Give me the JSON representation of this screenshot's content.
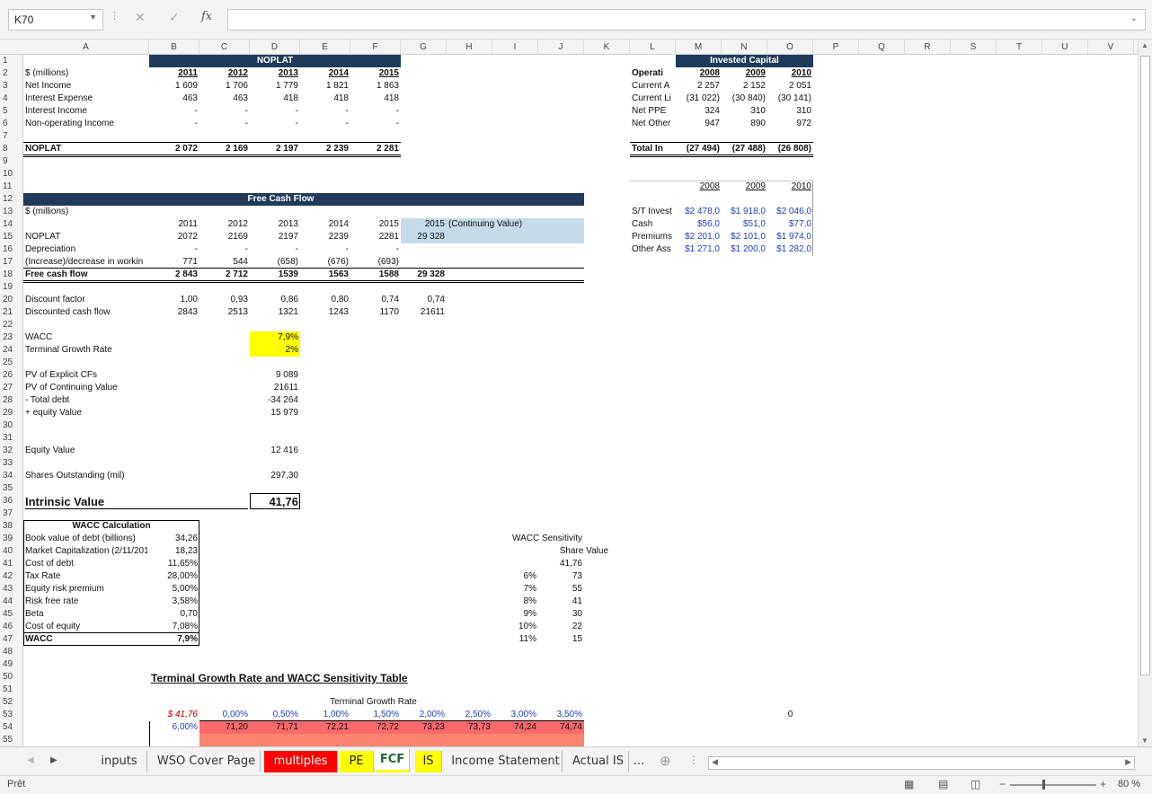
{
  "formula_bar": {
    "name_box": "K70",
    "cancel": "✕",
    "confirm": "✓",
    "fx": "fx",
    "formula": ""
  },
  "columns": [
    "A",
    "B",
    "C",
    "D",
    "E",
    "F",
    "G",
    "H",
    "I",
    "J",
    "K",
    "L",
    "M",
    "N",
    "O",
    "P",
    "Q",
    "R",
    "S",
    "T",
    "U",
    "V"
  ],
  "rows": [
    "1",
    "2",
    "3",
    "4",
    "5",
    "6",
    "7",
    "8",
    "9",
    "10",
    "11",
    "12",
    "13",
    "14",
    "15",
    "16",
    "17",
    "18",
    "19",
    "20",
    "21",
    "22",
    "23",
    "24",
    "25",
    "26",
    "27",
    "28",
    "29",
    "30",
    "31",
    "32",
    "33",
    "34",
    "35",
    "36",
    "37",
    "38",
    "39",
    "40",
    "41",
    "42",
    "43",
    "44",
    "45",
    "46",
    "47",
    "48",
    "49",
    "50",
    "51",
    "52",
    "53",
    "54",
    "55"
  ],
  "noplat": {
    "title": "NOPLAT",
    "unit": "$ (millions)",
    "years": [
      "2011",
      "2012",
      "2013",
      "2014",
      "2015"
    ],
    "rows": [
      {
        "label": "Net Income",
        "vals": [
          "1 609",
          "1 706",
          "1 779",
          "1 821",
          "1 863"
        ]
      },
      {
        "label": "Interest Expense",
        "vals": [
          "463",
          "463",
          "418",
          "418",
          "418"
        ]
      },
      {
        "label": "Interest Income",
        "vals": [
          "-",
          "-",
          "-",
          "-",
          "-"
        ]
      },
      {
        "label": "Non-operating Income",
        "vals": [
          "-",
          "-",
          "-",
          "-",
          "-"
        ]
      }
    ],
    "total_label": "NOPLAT",
    "total": [
      "2 072",
      "2 169",
      "2 197",
      "2 239",
      "2 281"
    ]
  },
  "invested_capital": {
    "title": "Invested Capital",
    "row_label": "Operati",
    "years": [
      "2008",
      "2009",
      "2010"
    ],
    "rows": [
      {
        "label": "Current A",
        "vals": [
          "2 257",
          "2 152",
          "2 051"
        ]
      },
      {
        "label": "Current Li",
        "vals": [
          "(31 022)",
          "(30 840)",
          "(30 141)"
        ]
      },
      {
        "label": "Net PPE",
        "vals": [
          "324",
          "310",
          "310"
        ]
      },
      {
        "label": "Net Other",
        "vals": [
          "947",
          "890",
          "972"
        ]
      }
    ],
    "total_label": "Total In",
    "total": [
      "(27 494)",
      "(27 488)",
      "(26 808)"
    ]
  },
  "other_table": {
    "years": [
      "2008",
      "2009",
      "2010"
    ],
    "rows": [
      {
        "label": "S/T Invest",
        "vals": [
          "$2 478,0",
          "$1 918,0",
          "$2 046,0"
        ]
      },
      {
        "label": "Cash",
        "vals": [
          "$56,0",
          "$51,0",
          "$77,0"
        ]
      },
      {
        "label": "Premiums",
        "vals": [
          "$2 201,0",
          "$2 101,0",
          "$1 974,0"
        ]
      },
      {
        "label": "Other Ass",
        "vals": [
          "$1 271,0",
          "$1 200,0",
          "$1 282,0"
        ]
      }
    ]
  },
  "fcf": {
    "title": "Free Cash Flow",
    "unit": "$ (millions)",
    "years": [
      "2011",
      "2012",
      "2013",
      "2014",
      "2015"
    ],
    "cont_year": "2015",
    "cont_label": "(Continuing Value)",
    "noplat_label": "NOPLAT",
    "noplat": [
      "2072",
      "2169",
      "2197",
      "2239",
      "2281"
    ],
    "noplat_cont": "29 328",
    "dep_label": "Depreciation",
    "dep": [
      "-",
      "-",
      "-",
      "-",
      "-"
    ],
    "wc_label": "(Increase)/decrease in workin",
    "wc": [
      "771",
      "544",
      "(658)",
      "(676)",
      "(693)"
    ],
    "fcf_label": "Free cash flow",
    "fcf_vals": [
      "2 843",
      "2 712",
      "1539",
      "1563",
      "1588"
    ],
    "fcf_cont": "29 328",
    "df_label": "Discount factor",
    "df": [
      "1,00",
      "0,93",
      "0,86",
      "0,80",
      "0,74"
    ],
    "df_cont": "0,74",
    "dcf_label": "Discounted cash flow",
    "dcf": [
      "2843",
      "2513",
      "1321",
      "1243",
      "1170"
    ],
    "dcf_cont": "21611"
  },
  "valuation": {
    "wacc_label": "WACC",
    "wacc": "7,9%",
    "tgr_label": "Terminal Growth Rate",
    "tgr": "2%",
    "pv_explicit_label": "PV of Explicit CFs",
    "pv_explicit": "9 089",
    "pv_cont_label": "PV of Continuing Value",
    "pv_cont": "21611",
    "debt_label": "- Total debt",
    "debt": "-34 264",
    "equity_plus_label": "+ equity Value",
    "equity_plus": "15 979",
    "equity_label": "Equity Value",
    "equity": "12 416",
    "shares_label": "Shares Outstanding (mil)",
    "shares": "297,30",
    "iv_label": "Intrinsic Value",
    "iv": "41,76"
  },
  "wacc_calc": {
    "title": "WACC Calculation",
    "rows": [
      {
        "label": "Book value of debt (billions)",
        "val": "34,26"
      },
      {
        "label": "Market Capitalization (2/11/201",
        "val": "18,23"
      },
      {
        "label": "Cost of debt",
        "val": "11,65%"
      },
      {
        "label": "Tax Rate",
        "val": "28,00%"
      },
      {
        "label": "Equity risk premium",
        "val": "5,00%"
      },
      {
        "label": "Risk free rate",
        "val": "3,58%"
      },
      {
        "label": "Beta",
        "val": "0,70"
      },
      {
        "label": "Cost of equity",
        "val": "7,08%"
      },
      {
        "label": "WACC",
        "val": "7,9%"
      }
    ]
  },
  "wacc_sens": {
    "title": "WACC Sensitivity",
    "sub": "Share Value",
    "base": "41,76",
    "rows": [
      {
        "w": "6%",
        "v": "73"
      },
      {
        "w": "7%",
        "v": "55"
      },
      {
        "w": "8%",
        "v": "41"
      },
      {
        "w": "9%",
        "v": "30"
      },
      {
        "w": "10%",
        "v": "22"
      },
      {
        "w": "11%",
        "v": "15"
      }
    ]
  },
  "tgr_table": {
    "title": "Terminal Growth Rate and WACC Sensitivity Table",
    "header": "Terminal Growth Rate",
    "corner": "$ 41,76",
    "rates": [
      "0,00%",
      "0,50%",
      "1,00%",
      "1,50%",
      "2,00%",
      "2,50%",
      "3,00%",
      "3,50%"
    ],
    "row_wacc": "6,00%",
    "row_vals": [
      "71,20",
      "71,71",
      "72,21",
      "72,72",
      "73,23",
      "73,73",
      "74,24",
      "74,74"
    ],
    "o53": "0",
    "colors": {
      "row54": "#f8696b",
      "row55": "#f98570"
    }
  },
  "tabs": [
    "inputs",
    "WSO Cover Page",
    "multiples",
    "PE",
    "FCF",
    "IS",
    "Income Statement",
    "Actual IS",
    "..."
  ],
  "tab_colors": {
    "multiples": "#ff0000",
    "PE": "#ffff00",
    "FCF": "#ffff00",
    "IS": "#ffff00"
  },
  "status": {
    "ready": "Prêt",
    "zoom": "80 %"
  }
}
